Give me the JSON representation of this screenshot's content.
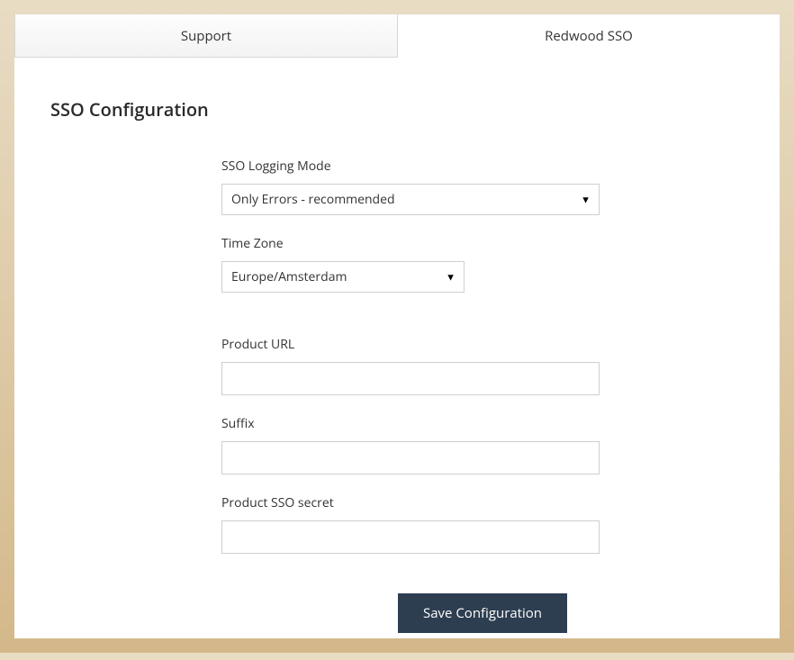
{
  "tabs": {
    "support": "Support",
    "redwood_sso": "Redwood SSO"
  },
  "page_title": "SSO Configuration",
  "form": {
    "logging_mode": {
      "label": "SSO Logging Mode",
      "value": "Only Errors - recommended"
    },
    "time_zone": {
      "label": "Time Zone",
      "value": "Europe/Amsterdam"
    },
    "product_url": {
      "label": "Product URL",
      "value": ""
    },
    "suffix": {
      "label": "Suffix",
      "value": ""
    },
    "product_sso_secret": {
      "label": "Product SSO secret",
      "value": ""
    }
  },
  "actions": {
    "save": "Save Configuration"
  }
}
